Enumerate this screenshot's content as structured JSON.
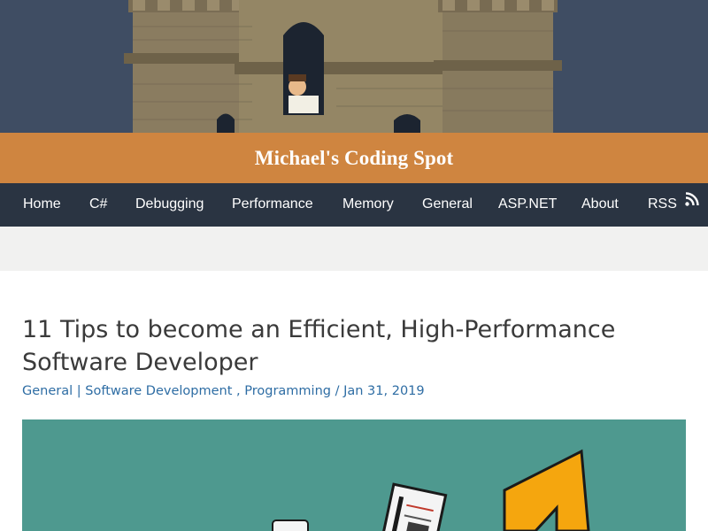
{
  "site": {
    "title": "Michael's Coding Spot"
  },
  "nav": {
    "items": [
      {
        "label": "Home"
      },
      {
        "label": "C#"
      },
      {
        "label": "Debugging"
      },
      {
        "label": "Performance"
      },
      {
        "label": "Memory"
      },
      {
        "label": "General"
      },
      {
        "label": "ASP.NET"
      },
      {
        "label": "About"
      },
      {
        "label": "RSS",
        "icon": "rss-icon"
      }
    ]
  },
  "article": {
    "title": "11 Tips to become an Efficient, High-Performance Software Developer",
    "meta": {
      "category": "General",
      "tag_1": "Software Development",
      "tag_2": "Programming",
      "date": "Jan 31, 2019"
    }
  },
  "colors": {
    "banner_sky": "#3f4d63",
    "title_bar": "#cf8540",
    "nav_bar": "#2a3442",
    "link": "#2e6da4",
    "featured_bg": "#4e998f",
    "arrow": "#f5a60e"
  }
}
